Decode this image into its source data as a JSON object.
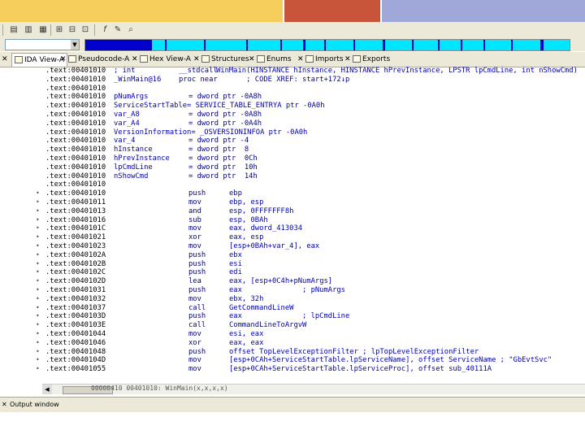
{
  "toolbar": {
    "buttons": [
      "list-icon",
      "chart-icon",
      "flowchart-icon",
      "xref-icon",
      "function-icon",
      "script-icon",
      "find-icon"
    ]
  },
  "nav": {
    "combo_value": "",
    "navbar_segments_color": "#0000cc",
    "navbar_bg_color": "#00e6ff"
  },
  "tabs": [
    {
      "label": "IDA View-A",
      "active": true
    },
    {
      "label": "Pseudocode-A",
      "active": false
    },
    {
      "label": "Hex View-A",
      "active": false
    },
    {
      "label": "Structures",
      "active": false
    },
    {
      "label": "Enums",
      "active": false
    },
    {
      "label": "Imports",
      "active": false
    },
    {
      "label": "Exports",
      "active": false
    }
  ],
  "lines": [
    {
      "addr": ".text:00401010",
      "label": "; int",
      "mn": "__stdcall",
      "op": "WinMain(HINSTANCE hInstance, HINSTANCE hPrevInstance, LPSTR lpCmdLine, int nShowCmd)"
    },
    {
      "addr": ".text:00401010",
      "label": "_WinMain@16",
      "mn": "proc near",
      "op": "    ; CODE XREF: start+172↓p"
    },
    {
      "addr": ".text:00401010",
      "label": "",
      "mn": "",
      "op": ""
    },
    {
      "addr": ".text:00401010",
      "label": "pNumArgs",
      "mn": "= dword ptr -0A8h",
      "op": ""
    },
    {
      "addr": ".text:00401010",
      "label": "ServiceStartTable= SERVICE_TABLE_ENTRYA ptr -0A0h",
      "mn": "",
      "op": ""
    },
    {
      "addr": ".text:00401010",
      "label": "var_A8",
      "mn": "= dword ptr -0A8h",
      "op": ""
    },
    {
      "addr": ".text:00401010",
      "label": "var_A4",
      "mn": "= dword ptr -0A4h",
      "op": ""
    },
    {
      "addr": ".text:00401010",
      "label": "VersionInformation= _OSVERSIONINFOA ptr -0A0h",
      "mn": "",
      "op": ""
    },
    {
      "addr": ".text:00401010",
      "label": "var_4",
      "mn": "= dword ptr -4",
      "op": ""
    },
    {
      "addr": ".text:00401010",
      "label": "hInstance",
      "mn": "= dword ptr  8",
      "op": ""
    },
    {
      "addr": ".text:00401010",
      "label": "hPrevInstance",
      "mn": "= dword ptr  0Ch",
      "op": ""
    },
    {
      "addr": ".text:00401010",
      "label": "lpCmdLine",
      "mn": "= dword ptr  10h",
      "op": ""
    },
    {
      "addr": ".text:00401010",
      "label": "nShowCmd",
      "mn": "= dword ptr  14h",
      "op": ""
    },
    {
      "addr": ".text:00401010",
      "label": "",
      "mn": "",
      "op": ""
    },
    {
      "addr": ".text:00401010",
      "label": "",
      "mn": "push",
      "op": "ebp"
    },
    {
      "addr": ".text:00401011",
      "label": "",
      "mn": "mov",
      "op": "ebp, esp"
    },
    {
      "addr": ".text:00401013",
      "label": "",
      "mn": "and",
      "op": "esp, 0FFFFFFF8h"
    },
    {
      "addr": ".text:00401016",
      "label": "",
      "mn": "sub",
      "op": "esp, 0BAh"
    },
    {
      "addr": ".text:0040101C",
      "label": "",
      "mn": "mov",
      "op": "eax, dword_413034"
    },
    {
      "addr": ".text:00401021",
      "label": "",
      "mn": "xor",
      "op": "eax, esp"
    },
    {
      "addr": ".text:00401023",
      "label": "",
      "mn": "mov",
      "op": "[esp+0BAh+var_4], eax"
    },
    {
      "addr": ".text:0040102A",
      "label": "",
      "mn": "push",
      "op": "ebx"
    },
    {
      "addr": ".text:0040102B",
      "label": "",
      "mn": "push",
      "op": "esi"
    },
    {
      "addr": ".text:0040102C",
      "label": "",
      "mn": "push",
      "op": "edi"
    },
    {
      "addr": ".text:0040102D",
      "label": "",
      "mn": "lea",
      "op": "eax, [esp+0C4h+pNumArgs]"
    },
    {
      "addr": ".text:00401031",
      "label": "",
      "mn": "push",
      "op": "eax",
      "cmt": "; pNumArgs"
    },
    {
      "addr": ".text:00401032",
      "label": "",
      "mn": "mov",
      "op": "ebx, 32h"
    },
    {
      "addr": ".text:00401037",
      "label": "",
      "mn": "call",
      "op": "GetCommandLineW"
    },
    {
      "addr": ".text:0040103D",
      "label": "",
      "mn": "push",
      "op": "eax",
      "cmt": "; lpCmdLine"
    },
    {
      "addr": ".text:0040103E",
      "label": "",
      "mn": "call",
      "op": "CommandLineToArgvW"
    },
    {
      "addr": ".text:00401044",
      "label": "",
      "mn": "mov",
      "op": "esi, eax"
    },
    {
      "addr": ".text:00401046",
      "label": "",
      "mn": "xor",
      "op": "eax, eax"
    },
    {
      "addr": ".text:00401048",
      "label": "",
      "mn": "push",
      "op": "offset TopLevelExceptionFilter ; lpTopLevelExceptionFilter"
    },
    {
      "addr": ".text:0040104D",
      "label": "",
      "mn": "mov",
      "op": "[esp+0CAh+ServiceStartTable.lpServiceName], offset ServiceName ; \"GbEvtSvc\""
    },
    {
      "addr": ".text:00401055",
      "label": "",
      "mn": "mov",
      "op": "[esp+0CAh+ServiceStartTable.lpServiceProc], offset sub_40111A"
    }
  ],
  "status": {
    "position_text": "00000410 00401010: WinMain(x,x,x,x)"
  },
  "output": {
    "tab_label": "Output window"
  }
}
